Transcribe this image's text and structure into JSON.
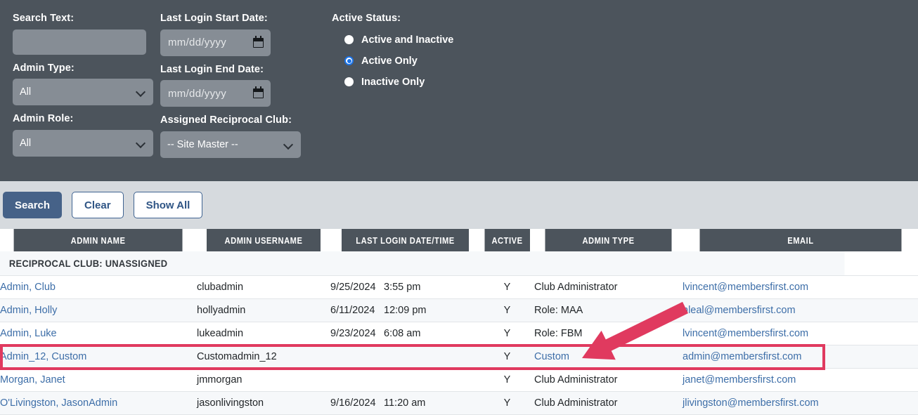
{
  "filters": {
    "search_text": {
      "label": "Search Text:",
      "value": "",
      "placeholder": ""
    },
    "admin_type": {
      "label": "Admin Type:",
      "value": "All",
      "icon": "chevron-down-icon"
    },
    "admin_role": {
      "label": "Admin Role:",
      "value": "All",
      "icon": "chevron-down-icon"
    },
    "last_login_start": {
      "label": "Last Login Start Date:",
      "placeholder": "mm/dd/yyyy",
      "value": "",
      "icon": "calendar-icon"
    },
    "last_login_end": {
      "label": "Last Login End Date:",
      "placeholder": "mm/dd/yyyy",
      "value": "",
      "icon": "calendar-icon"
    },
    "reciprocal_club": {
      "label": "Assigned Reciprocal Club:",
      "value": "-- Site Master --",
      "icon": "chevron-down-icon"
    },
    "active_status": {
      "label": "Active Status:",
      "options": [
        {
          "label": "Active and Inactive",
          "selected": false
        },
        {
          "label": "Active Only",
          "selected": true
        },
        {
          "label": "Inactive Only",
          "selected": false
        }
      ]
    }
  },
  "buttons": {
    "search": "Search",
    "clear": "Clear",
    "show_all": "Show All"
  },
  "table": {
    "columns": [
      "Admin Name",
      "Admin Username",
      "Last Login Date/Time",
      "Active",
      "Admin Type",
      "Email"
    ],
    "group_label": "Reciprocal Club: Unassigned",
    "rows": [
      {
        "name": "Admin, Club",
        "username": "clubadmin",
        "login_date": "9/25/2024",
        "login_time": "3:55 pm",
        "active": "Y",
        "admin_type": "Club Administrator",
        "admin_type_link": false,
        "email": "lvincent@membersfirst.com",
        "highlighted": false
      },
      {
        "name": "Admin, Holly",
        "username": "hollyadmin",
        "login_date": "6/11/2024",
        "login_time": "12:09 pm",
        "active": "Y",
        "admin_type": "Role: MAA",
        "admin_type_link": false,
        "email": "hleal@membersfirst.com",
        "highlighted": false
      },
      {
        "name": "Admin, Luke",
        "username": "lukeadmin",
        "login_date": "9/23/2024",
        "login_time": "6:08 am",
        "active": "Y",
        "admin_type": "Role: FBM",
        "admin_type_link": false,
        "email": "lvincent@membersfirst.com",
        "highlighted": false
      },
      {
        "name": "Admin_12, Custom",
        "username": "Customadmin_12",
        "login_date": "",
        "login_time": "",
        "active": "Y",
        "admin_type": "Custom",
        "admin_type_link": true,
        "email": "admin@membersfirst.com",
        "highlighted": true
      },
      {
        "name": "Morgan, Janet",
        "username": "jmmorgan",
        "login_date": "",
        "login_time": "",
        "active": "Y",
        "admin_type": "Club Administrator",
        "admin_type_link": false,
        "email": "janet@membersfirst.com",
        "highlighted": false
      },
      {
        "name": "O'Livingston, JasonAdmin",
        "username": "jasonlivingston",
        "login_date": "9/16/2024",
        "login_time": "11:20 am",
        "active": "Y",
        "admin_type": "Club Administrator",
        "admin_type_link": false,
        "email": "jlivingston@membersfirst.com",
        "highlighted": false
      }
    ]
  },
  "annotation": {
    "highlight_color": "#e03a5f",
    "arrow": {
      "name": "pointer-arrow",
      "points_to": "Custom"
    }
  },
  "colors": {
    "panel_bg": "#4c545c",
    "input_bg": "#868d95",
    "button_bar_bg": "#d6dade",
    "primary_button": "#466288",
    "link": "#3d6ea8",
    "header_bg": "#4c545c",
    "row_alt_bg": "#f6f8fa"
  }
}
